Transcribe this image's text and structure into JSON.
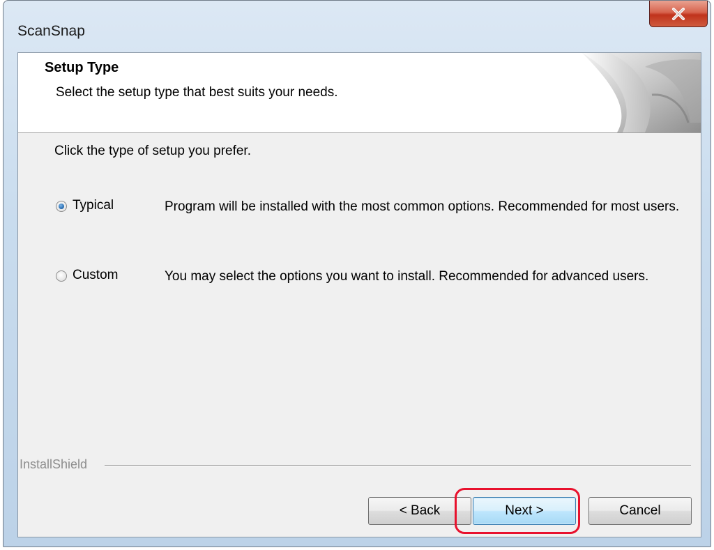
{
  "window": {
    "title": "ScanSnap",
    "close_glyph": "x"
  },
  "header": {
    "title": "Setup Type",
    "subtitle": "Select the setup type that best suits your needs."
  },
  "main": {
    "prompt": "Click the type of setup you prefer.",
    "options": [
      {
        "label": "Typical",
        "description": "Program will be installed with the most common options. Recommended for most users.",
        "selected": true
      },
      {
        "label": "Custom",
        "description": "You may select the options you want to install. Recommended for advanced users.",
        "selected": false
      }
    ]
  },
  "footer": {
    "brand": "InstallShield",
    "back_label": "< Back",
    "next_label": "Next >",
    "cancel_label": "Cancel"
  },
  "colors": {
    "annotation_ring": "#e8112d",
    "close_button": "#c0331c",
    "radio_selected": "#2a6fb3"
  },
  "icons": {
    "close": "close-icon",
    "header_art": "page-curl-icon"
  }
}
